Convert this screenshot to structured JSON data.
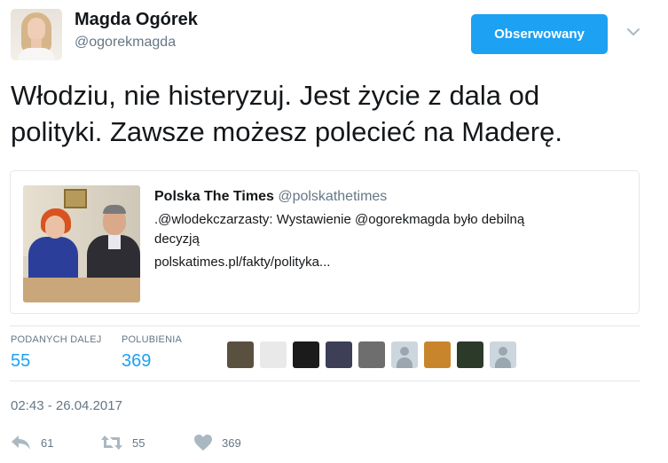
{
  "author": {
    "name": "Magda Ogórek",
    "handle": "@ogorekmagda"
  },
  "follow_button": {
    "label": "Obserwowany"
  },
  "tweet": {
    "line1": "Włodziu, nie histeryzuj. Jest życie z dala od",
    "line2": "polityki. Zawsze możesz polecieć na Maderę."
  },
  "quote": {
    "author_name": "Polska The Times",
    "author_handle": "@polskathetimes",
    "text_line1": ".@wlodekczarzasty: Wystawienie @ogorekmagda było debilną",
    "text_line2": "decyzją",
    "link": "polskatimes.pl/fakty/polityka..."
  },
  "stats": {
    "retweets_label": "PODANYCH DALEJ",
    "retweets_value": "55",
    "likes_label": "POLUBIENIA",
    "likes_value": "369"
  },
  "likers": [
    {
      "kind": "photo",
      "color": "#5a5040"
    },
    {
      "kind": "photo",
      "color": "#e9e9e9"
    },
    {
      "kind": "photo",
      "color": "#1b1b1b"
    },
    {
      "kind": "photo",
      "color": "#3c3f55"
    },
    {
      "kind": "photo",
      "color": "#6e6e6e"
    },
    {
      "kind": "default",
      "color": "#ccd6dd"
    },
    {
      "kind": "photo",
      "color": "#c9852c"
    },
    {
      "kind": "photo",
      "color": "#2c3a2a"
    },
    {
      "kind": "default",
      "color": "#ccd6dd"
    }
  ],
  "timestamp": "02:43 - 26.04.2017",
  "actions": {
    "reply_count": "61",
    "retweet_count": "55",
    "like_count": "369"
  },
  "colors": {
    "accent": "#1da1f2",
    "muted": "#657786",
    "border": "#e1e8ed"
  }
}
